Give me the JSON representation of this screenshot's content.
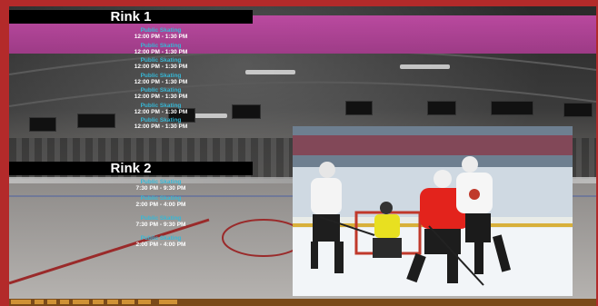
{
  "rink1": {
    "title": "Rink 1",
    "events": [
      {
        "name": "Public Skating",
        "time": "12:00 PM - 1:30 PM"
      },
      {
        "name": "Public Skating",
        "time": "12:00 PM - 1:30 PM"
      },
      {
        "name": "Public Skating",
        "time": "12:00 PM - 1:30 PM"
      },
      {
        "name": "Public Skating",
        "time": "12:00 PM - 1:30 PM"
      },
      {
        "name": "Public Skating",
        "time": "12:00 PM - 1:30 PM"
      },
      {
        "name": "Public Skating",
        "time": "12:00 PM - 1:30 PM"
      },
      {
        "name": "Public Skating",
        "time": "12:00 PM - 1:30 PM"
      }
    ]
  },
  "rink2": {
    "title": "Rink 2",
    "events": [
      {
        "name": "Public Skating",
        "time": "7:30 PM - 9:30 PM"
      },
      {
        "name": "Public Skating",
        "time": "2:00 PM - 4:00 PM"
      },
      {
        "name": "Public Skating",
        "time": "7:30 PM - 9:30 PM"
      },
      {
        "name": "Public Skating",
        "time": "2:00 PM - 4:00 PM"
      }
    ]
  },
  "colors": {
    "frame": "#b32a2a",
    "banner": "#a23b8a",
    "event_name": "#36b8d6",
    "event_time": "#ffffff"
  }
}
